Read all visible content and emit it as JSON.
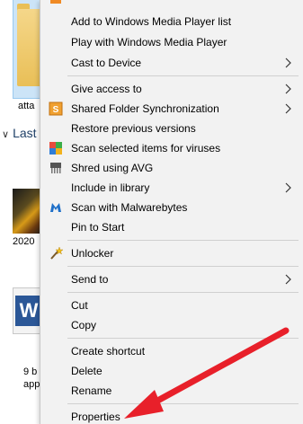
{
  "background": {
    "folder_label": "atta",
    "section_label": "Last",
    "photo_label": "2020",
    "word_label_line1": "9 b",
    "word_label_line2": "app"
  },
  "menu": {
    "items": [
      {
        "label": "Add to Windows Media Player list",
        "icon": "none",
        "submenu": false
      },
      {
        "label": "Play with Windows Media Player",
        "icon": "none",
        "submenu": false
      },
      {
        "label": "Cast to Device",
        "icon": "none",
        "submenu": true
      },
      {
        "label": "Give access to",
        "icon": "none",
        "submenu": true
      },
      {
        "label": "Shared Folder Synchronization",
        "icon": "sync-icon",
        "submenu": true
      },
      {
        "label": "Restore previous versions",
        "icon": "none",
        "submenu": false
      },
      {
        "label": "Scan selected items for viruses",
        "icon": "antivirus-icon",
        "submenu": false
      },
      {
        "label": "Shred using AVG",
        "icon": "shredder-icon",
        "submenu": false
      },
      {
        "label": "Include in library",
        "icon": "none",
        "submenu": true
      },
      {
        "label": "Scan with Malwarebytes",
        "icon": "malwarebytes-icon",
        "submenu": false
      },
      {
        "label": "Pin to Start",
        "icon": "none",
        "submenu": false
      },
      {
        "label": "Unlocker",
        "icon": "wand-icon",
        "submenu": false
      },
      {
        "label": "Send to",
        "icon": "none",
        "submenu": true
      },
      {
        "label": "Cut",
        "icon": "none",
        "submenu": false
      },
      {
        "label": "Copy",
        "icon": "none",
        "submenu": false
      },
      {
        "label": "Create shortcut",
        "icon": "none",
        "submenu": false
      },
      {
        "label": "Delete",
        "icon": "none",
        "submenu": false
      },
      {
        "label": "Rename",
        "icon": "none",
        "submenu": false
      },
      {
        "label": "Properties",
        "icon": "none",
        "submenu": false
      }
    ]
  },
  "colors": {
    "menu_background": "#f2f2f2",
    "separator": "#d0d0d0",
    "annotation_arrow": "#e8202a"
  }
}
